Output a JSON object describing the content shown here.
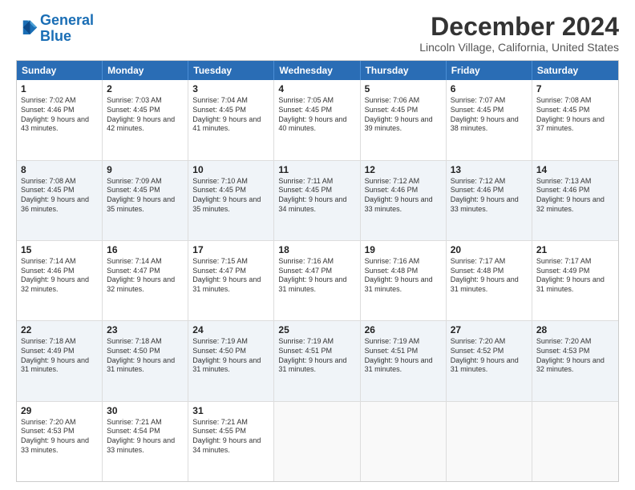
{
  "header": {
    "logo_line1": "General",
    "logo_line2": "Blue",
    "title": "December 2024",
    "subtitle": "Lincoln Village, California, United States"
  },
  "calendar": {
    "days_of_week": [
      "Sunday",
      "Monday",
      "Tuesday",
      "Wednesday",
      "Thursday",
      "Friday",
      "Saturday"
    ],
    "rows": [
      [
        {
          "day": "1",
          "sunrise": "Sunrise: 7:02 AM",
          "sunset": "Sunset: 4:46 PM",
          "daylight": "Daylight: 9 hours and 43 minutes."
        },
        {
          "day": "2",
          "sunrise": "Sunrise: 7:03 AM",
          "sunset": "Sunset: 4:45 PM",
          "daylight": "Daylight: 9 hours and 42 minutes."
        },
        {
          "day": "3",
          "sunrise": "Sunrise: 7:04 AM",
          "sunset": "Sunset: 4:45 PM",
          "daylight": "Daylight: 9 hours and 41 minutes."
        },
        {
          "day": "4",
          "sunrise": "Sunrise: 7:05 AM",
          "sunset": "Sunset: 4:45 PM",
          "daylight": "Daylight: 9 hours and 40 minutes."
        },
        {
          "day": "5",
          "sunrise": "Sunrise: 7:06 AM",
          "sunset": "Sunset: 4:45 PM",
          "daylight": "Daylight: 9 hours and 39 minutes."
        },
        {
          "day": "6",
          "sunrise": "Sunrise: 7:07 AM",
          "sunset": "Sunset: 4:45 PM",
          "daylight": "Daylight: 9 hours and 38 minutes."
        },
        {
          "day": "7",
          "sunrise": "Sunrise: 7:08 AM",
          "sunset": "Sunset: 4:45 PM",
          "daylight": "Daylight: 9 hours and 37 minutes."
        }
      ],
      [
        {
          "day": "8",
          "sunrise": "Sunrise: 7:08 AM",
          "sunset": "Sunset: 4:45 PM",
          "daylight": "Daylight: 9 hours and 36 minutes."
        },
        {
          "day": "9",
          "sunrise": "Sunrise: 7:09 AM",
          "sunset": "Sunset: 4:45 PM",
          "daylight": "Daylight: 9 hours and 35 minutes."
        },
        {
          "day": "10",
          "sunrise": "Sunrise: 7:10 AM",
          "sunset": "Sunset: 4:45 PM",
          "daylight": "Daylight: 9 hours and 35 minutes."
        },
        {
          "day": "11",
          "sunrise": "Sunrise: 7:11 AM",
          "sunset": "Sunset: 4:45 PM",
          "daylight": "Daylight: 9 hours and 34 minutes."
        },
        {
          "day": "12",
          "sunrise": "Sunrise: 7:12 AM",
          "sunset": "Sunset: 4:46 PM",
          "daylight": "Daylight: 9 hours and 33 minutes."
        },
        {
          "day": "13",
          "sunrise": "Sunrise: 7:12 AM",
          "sunset": "Sunset: 4:46 PM",
          "daylight": "Daylight: 9 hours and 33 minutes."
        },
        {
          "day": "14",
          "sunrise": "Sunrise: 7:13 AM",
          "sunset": "Sunset: 4:46 PM",
          "daylight": "Daylight: 9 hours and 32 minutes."
        }
      ],
      [
        {
          "day": "15",
          "sunrise": "Sunrise: 7:14 AM",
          "sunset": "Sunset: 4:46 PM",
          "daylight": "Daylight: 9 hours and 32 minutes."
        },
        {
          "day": "16",
          "sunrise": "Sunrise: 7:14 AM",
          "sunset": "Sunset: 4:47 PM",
          "daylight": "Daylight: 9 hours and 32 minutes."
        },
        {
          "day": "17",
          "sunrise": "Sunrise: 7:15 AM",
          "sunset": "Sunset: 4:47 PM",
          "daylight": "Daylight: 9 hours and 31 minutes."
        },
        {
          "day": "18",
          "sunrise": "Sunrise: 7:16 AM",
          "sunset": "Sunset: 4:47 PM",
          "daylight": "Daylight: 9 hours and 31 minutes."
        },
        {
          "day": "19",
          "sunrise": "Sunrise: 7:16 AM",
          "sunset": "Sunset: 4:48 PM",
          "daylight": "Daylight: 9 hours and 31 minutes."
        },
        {
          "day": "20",
          "sunrise": "Sunrise: 7:17 AM",
          "sunset": "Sunset: 4:48 PM",
          "daylight": "Daylight: 9 hours and 31 minutes."
        },
        {
          "day": "21",
          "sunrise": "Sunrise: 7:17 AM",
          "sunset": "Sunset: 4:49 PM",
          "daylight": "Daylight: 9 hours and 31 minutes."
        }
      ],
      [
        {
          "day": "22",
          "sunrise": "Sunrise: 7:18 AM",
          "sunset": "Sunset: 4:49 PM",
          "daylight": "Daylight: 9 hours and 31 minutes."
        },
        {
          "day": "23",
          "sunrise": "Sunrise: 7:18 AM",
          "sunset": "Sunset: 4:50 PM",
          "daylight": "Daylight: 9 hours and 31 minutes."
        },
        {
          "day": "24",
          "sunrise": "Sunrise: 7:19 AM",
          "sunset": "Sunset: 4:50 PM",
          "daylight": "Daylight: 9 hours and 31 minutes."
        },
        {
          "day": "25",
          "sunrise": "Sunrise: 7:19 AM",
          "sunset": "Sunset: 4:51 PM",
          "daylight": "Daylight: 9 hours and 31 minutes."
        },
        {
          "day": "26",
          "sunrise": "Sunrise: 7:19 AM",
          "sunset": "Sunset: 4:51 PM",
          "daylight": "Daylight: 9 hours and 31 minutes."
        },
        {
          "day": "27",
          "sunrise": "Sunrise: 7:20 AM",
          "sunset": "Sunset: 4:52 PM",
          "daylight": "Daylight: 9 hours and 31 minutes."
        },
        {
          "day": "28",
          "sunrise": "Sunrise: 7:20 AM",
          "sunset": "Sunset: 4:53 PM",
          "daylight": "Daylight: 9 hours and 32 minutes."
        }
      ],
      [
        {
          "day": "29",
          "sunrise": "Sunrise: 7:20 AM",
          "sunset": "Sunset: 4:53 PM",
          "daylight": "Daylight: 9 hours and 33 minutes."
        },
        {
          "day": "30",
          "sunrise": "Sunrise: 7:21 AM",
          "sunset": "Sunset: 4:54 PM",
          "daylight": "Daylight: 9 hours and 33 minutes."
        },
        {
          "day": "31",
          "sunrise": "Sunrise: 7:21 AM",
          "sunset": "Sunset: 4:55 PM",
          "daylight": "Daylight: 9 hours and 34 minutes."
        },
        null,
        null,
        null,
        null
      ]
    ]
  }
}
